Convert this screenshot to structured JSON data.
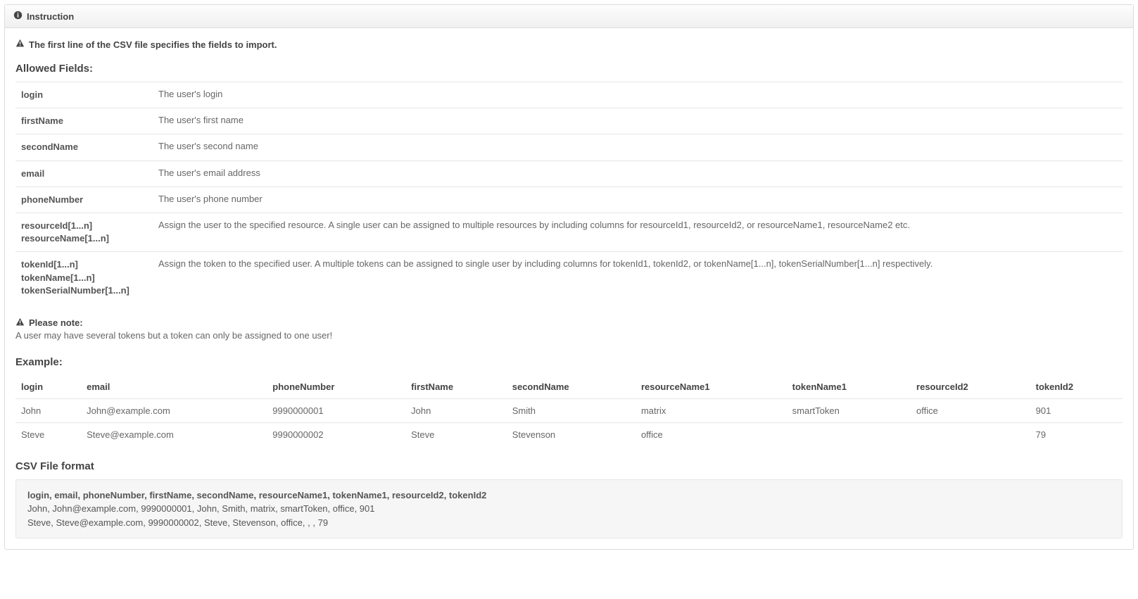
{
  "panel": {
    "title": "Instruction"
  },
  "intro": "The first line of the CSV file specifies the fields to import.",
  "allowed_heading": "Allowed Fields:",
  "fields": [
    {
      "keys": [
        "login"
      ],
      "desc": "The user's login"
    },
    {
      "keys": [
        "firstName"
      ],
      "desc": "The user's first name"
    },
    {
      "keys": [
        "secondName"
      ],
      "desc": "The user's second name"
    },
    {
      "keys": [
        "email"
      ],
      "desc": "The user's email address"
    },
    {
      "keys": [
        "phoneNumber"
      ],
      "desc": "The user's phone number"
    },
    {
      "keys": [
        "resourceId[1...n]",
        "resourceName[1...n]"
      ],
      "desc": "Assign the user to the specified resource. A single user can be assigned to multiple resources by including columns for resourceId1, resourceId2, or resourceName1, resourceName2 etc."
    },
    {
      "keys": [
        "tokenId[1...n]",
        "tokenName[1...n]",
        "tokenSerialNumber[1...n]"
      ],
      "desc": "Assign the token to the specified user. A multiple tokens can be assigned to single user by including columns for tokenId1, tokenId2, or tokenName[1...n], tokenSerialNumber[1...n] respectively."
    }
  ],
  "note": {
    "title": "Please note:",
    "text": "A user may have several tokens but a token can only be assigned to one user!"
  },
  "example_heading": "Example:",
  "example": {
    "columns": [
      "login",
      "email",
      "phoneNumber",
      "firstName",
      "secondName",
      "resourceName1",
      "tokenName1",
      "resourceId2",
      "tokenId2"
    ],
    "rows": [
      [
        "John",
        "John@example.com",
        "9990000001",
        "John",
        "Smith",
        "matrix",
        "smartToken",
        "office",
        "901"
      ],
      [
        "Steve",
        "Steve@example.com",
        "9990000002",
        "Steve",
        "Stevenson",
        "office",
        "",
        "",
        "79"
      ]
    ]
  },
  "csv_heading": "CSV File format",
  "csv": {
    "header": "login, email, phoneNumber, firstName, secondName, resourceName1, tokenName1, resourceId2, tokenId2",
    "lines": [
      "John, John@example.com, 9990000001, John, Smith, matrix, smartToken, office, 901",
      "Steve, Steve@example.com, 9990000002, Steve, Stevenson, office, , , 79"
    ]
  }
}
